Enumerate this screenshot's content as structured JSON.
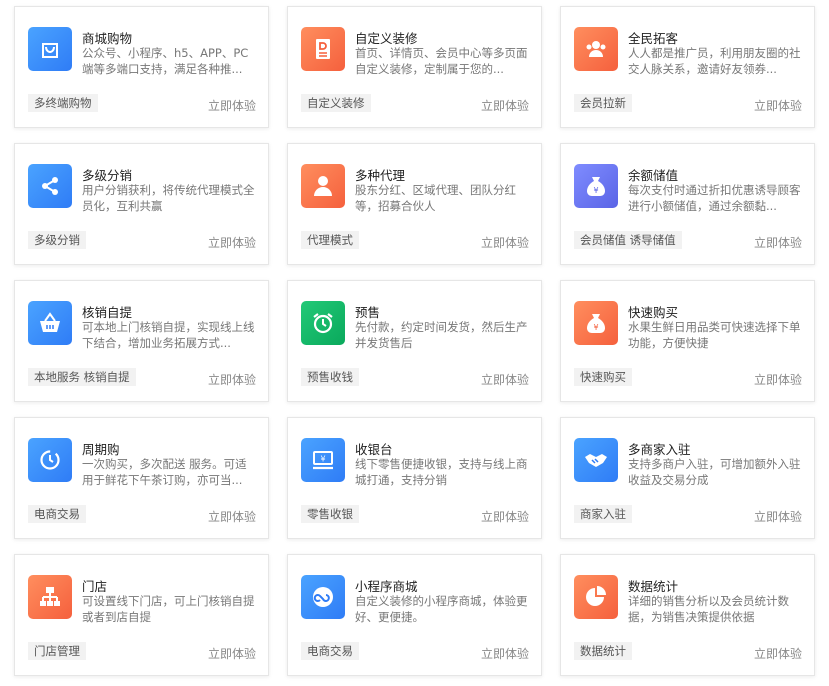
{
  "cards": [
    {
      "title": "商城购物",
      "desc": "公众号、小程序、h5、APP、PC端等多端口支持，满足各种推...",
      "tag": "多终端购物",
      "action": "立即体验",
      "icon": "shopping-bag-icon",
      "color": "blue"
    },
    {
      "title": "自定义装修",
      "desc": "首页、详情页、会员中心等多页面自定义装修，定制属于您的...",
      "tag": "自定义装修",
      "action": "立即体验",
      "icon": "document-d-icon",
      "color": "orange"
    },
    {
      "title": "全民拓客",
      "desc": "人人都是推广员，利用朋友圈的社交人脉关系，邀请好友领券...",
      "tag": "会员拉新",
      "action": "立即体验",
      "icon": "group-users-icon",
      "color": "orange"
    },
    {
      "title": "多级分销",
      "desc": "用户分销获利，将传统代理模式全员化，互利共赢",
      "tag": "多级分销",
      "action": "立即体验",
      "icon": "share-nodes-icon",
      "color": "blue"
    },
    {
      "title": "多种代理",
      "desc": "股东分红、区域代理、团队分红等，招募合伙人",
      "tag": "代理模式",
      "action": "立即体验",
      "icon": "user-icon",
      "color": "orange"
    },
    {
      "title": "余额储值",
      "desc": "每次支付时通过折扣优惠诱导顾客进行小额储值，通过余额黏...",
      "tag": "会员储值 诱导储值",
      "action": "立即体验",
      "icon": "money-bag-icon",
      "color": "purple"
    },
    {
      "title": "核销自提",
      "desc": "可本地上门核销自提，实现线上线下结合，增加业务拓展方式...",
      "tag": "本地服务 核销自提",
      "action": "立即体验",
      "icon": "basket-icon",
      "color": "blue"
    },
    {
      "title": "预售",
      "desc": "先付款，约定时间发货，然后生产并发货售后",
      "tag": "预售收钱",
      "action": "立即体验",
      "icon": "alarm-clock-icon",
      "color": "green"
    },
    {
      "title": "快速购买",
      "desc": "水果生鲜日用品类可快速选择下单功能，方便快捷",
      "tag": "快速购买",
      "action": "立即体验",
      "icon": "money-bag-icon",
      "color": "orange"
    },
    {
      "title": "周期购",
      "desc": "一次购买，多次配送 服务。可适用于鲜花下午茶订购，亦可当...",
      "tag": "电商交易",
      "action": "立即体验",
      "icon": "cycle-clock-icon",
      "color": "blue"
    },
    {
      "title": "收银台",
      "desc": "线下零售便捷收银，支持与线上商城打通，支持分销",
      "tag": "零售收银",
      "action": "立即体验",
      "icon": "cash-register-icon",
      "color": "blue"
    },
    {
      "title": "多商家入驻",
      "desc": "支持多商户入驻，可增加额外入驻收益及交易分成",
      "tag": "商家入驻",
      "action": "立即体验",
      "icon": "handshake-icon",
      "color": "blue"
    },
    {
      "title": "门店",
      "desc": "可设置线下门店，可上门核销自提或者到店自提",
      "tag": "门店管理",
      "action": "立即体验",
      "icon": "org-chart-icon",
      "color": "orange"
    },
    {
      "title": "小程序商城",
      "desc": "自定义装修的小程序商城，体验更好、更便捷。",
      "tag": "电商交易",
      "action": "立即体验",
      "icon": "link-icon",
      "color": "blue"
    },
    {
      "title": "数据统计",
      "desc": "详细的销售分析以及会员统计数据，为销售决策提供依据",
      "tag": "数据统计",
      "action": "立即体验",
      "icon": "pie-chart-icon",
      "color": "orange"
    }
  ]
}
